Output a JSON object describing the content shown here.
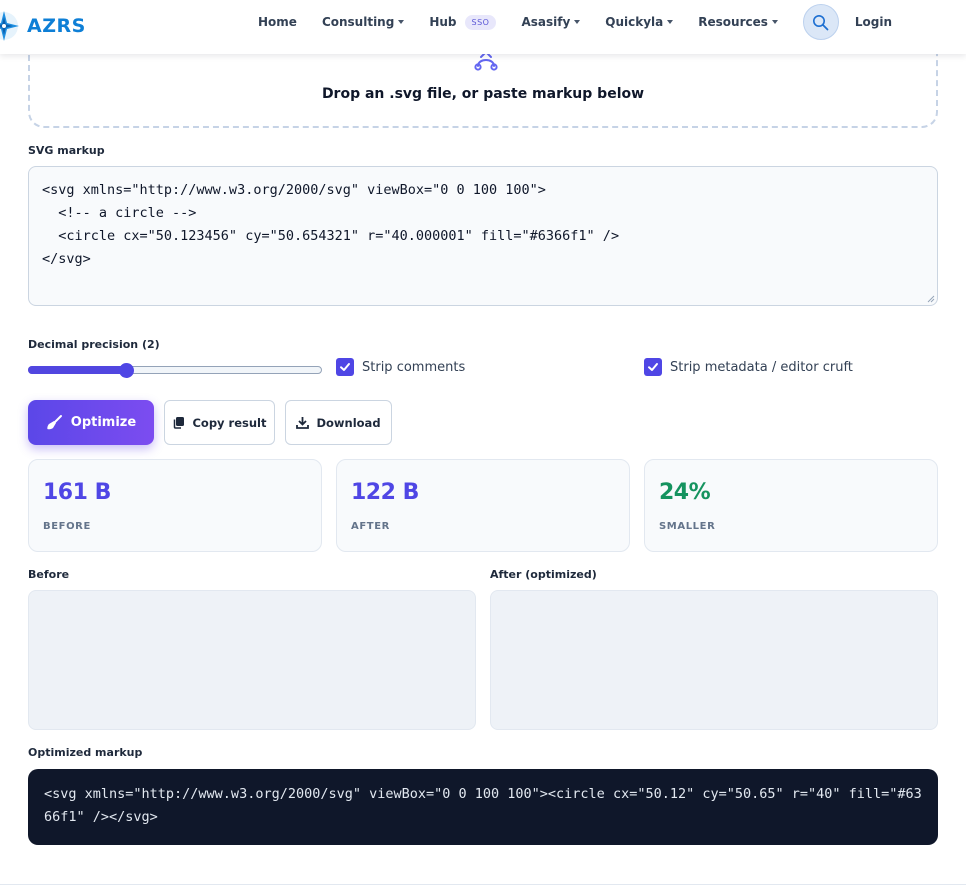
{
  "brand": {
    "name": "AZRS",
    "icon": "azrs-logo-icon"
  },
  "nav": {
    "home": "Home",
    "consulting": "Consulting",
    "hub": "Hub",
    "hub_badge": "SSO",
    "asasify": "Asasify",
    "quickyla": "Quickyla",
    "resources": "Resources",
    "search_icon": "search-icon",
    "login": "Login"
  },
  "dropzone": {
    "icon": "upload-icon",
    "text": "Drop an .svg file, or paste markup below"
  },
  "svg_markup": {
    "label": "SVG markup",
    "value": "<svg xmlns=\"http://www.w3.org/2000/svg\" viewBox=\"0 0 100 100\">\n  <!-- a circle -->\n  <circle cx=\"50.123456\" cy=\"50.654321\" r=\"40.000001\" fill=\"#6366f1\" />\n</svg>"
  },
  "options": {
    "precision_label": "Decimal precision (2)",
    "precision": {
      "value": 2,
      "min": 0,
      "max": 6
    },
    "strip_comments": {
      "label": "Strip comments",
      "checked": true
    },
    "strip_metadata": {
      "label": "Strip metadata / editor cruft",
      "checked": true
    }
  },
  "actions": {
    "optimize": "Optimize",
    "optimize_icon": "broom-icon",
    "copy": "Copy result",
    "copy_icon": "copy-icon",
    "download": "Download",
    "download_icon": "download-icon"
  },
  "stats": [
    {
      "value": "161 B",
      "label": "BEFORE",
      "color": "#4f46e5"
    },
    {
      "value": "122 B",
      "label": "AFTER",
      "color": "#4f46e5"
    },
    {
      "value": "24%",
      "label": "SMALLER",
      "color": "#15935f"
    }
  ],
  "previews": {
    "before_label": "Before",
    "after_label": "After (optimized)"
  },
  "output": {
    "label": "Optimized markup",
    "value": "<svg xmlns=\"http://www.w3.org/2000/svg\" viewBox=\"0 0 100 100\"><circle cx=\"50.12\" cy=\"50.65\" r=\"40\" fill=\"#6366f1\" /></svg>"
  },
  "colors": {
    "accent": "#4f46e5",
    "brand": "#0e7fd6",
    "success": "#15935f",
    "code_bg": "#0f172a"
  }
}
